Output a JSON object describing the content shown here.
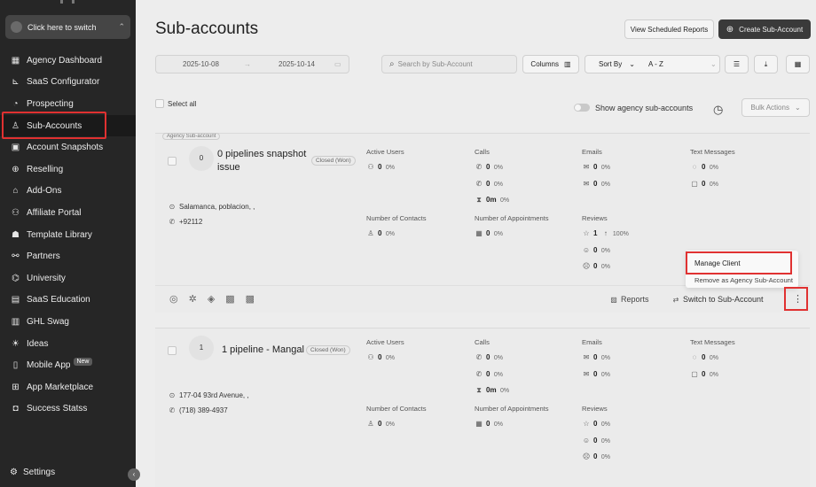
{
  "switcher": {
    "label": "Click here to switch"
  },
  "nav": [
    {
      "label": "Agency Dashboard",
      "icon": "dashboard-icon",
      "glyph": "▦"
    },
    {
      "label": "SaaS Configurator",
      "icon": "chart-icon",
      "glyph": "⊾"
    },
    {
      "label": "Prospecting",
      "icon": "prospecting-icon",
      "glyph": "◔"
    },
    {
      "label": "Sub-Accounts",
      "icon": "user-icon",
      "glyph": "♙",
      "active": true
    },
    {
      "label": "Account Snapshots",
      "icon": "snapshot-icon",
      "glyph": "▣"
    },
    {
      "label": "Reselling",
      "icon": "reselling-icon",
      "glyph": "⊕"
    },
    {
      "label": "Add-Ons",
      "icon": "bag-icon",
      "glyph": "⌂"
    },
    {
      "label": "Affiliate Portal",
      "icon": "affiliate-icon",
      "glyph": "⚇"
    },
    {
      "label": "Template Library",
      "icon": "template-icon",
      "glyph": "☗"
    },
    {
      "label": "Partners",
      "icon": "handshake-icon",
      "glyph": "⚯"
    },
    {
      "label": "University",
      "icon": "graduation-icon",
      "glyph": "⌬"
    },
    {
      "label": "SaaS Education",
      "icon": "education-icon",
      "glyph": "▤"
    },
    {
      "label": "GHL Swag",
      "icon": "swag-icon",
      "glyph": "▥"
    },
    {
      "label": "Ideas",
      "icon": "bulb-icon",
      "glyph": "☀"
    },
    {
      "label": "Mobile App",
      "icon": "mobile-icon",
      "glyph": "▯",
      "badge": "New"
    },
    {
      "label": "App Marketplace",
      "icon": "marketplace-icon",
      "glyph": "⊞"
    },
    {
      "label": "Success Statss",
      "icon": "stats-icon",
      "glyph": "◘"
    }
  ],
  "settings": {
    "label": "Settings"
  },
  "page": {
    "title": "Sub-accounts"
  },
  "header": {
    "view_reports": "View Scheduled Reports",
    "create": "Create Sub-Account"
  },
  "filters": {
    "date_from": "2025-10-08",
    "date_to": "2025-10-14",
    "search_placeholder": "Search by Sub-Account",
    "columns": "Columns",
    "sort_by": "Sort By",
    "sort_value": "A - Z"
  },
  "bulk": {
    "select_all": "Select all",
    "show_agency": "Show agency sub-accounts",
    "bulk_actions": "Bulk Actions"
  },
  "labels": {
    "active_users": "Active Users",
    "calls": "Calls",
    "emails": "Emails",
    "text_messages": "Text Messages",
    "contacts": "Number of Contacts",
    "appointments": "Number of Appointments",
    "reviews": "Reviews"
  },
  "cards": [
    {
      "tag": "Agency Sub-account",
      "index": "0",
      "name_line1": "0 pipelines snapshot",
      "name_line2": "issue",
      "status": "Closed (Won)",
      "address": "Salamanca, poblacion, ,",
      "phone": "+92112",
      "active_users": {
        "v": "0",
        "p": "0%"
      },
      "calls": [
        {
          "v": "0",
          "p": "0%"
        },
        {
          "v": "0",
          "p": "0%"
        },
        {
          "v": "0m",
          "p": "0%"
        }
      ],
      "emails": [
        {
          "v": "0",
          "p": "0%"
        },
        {
          "v": "0",
          "p": "0%"
        }
      ],
      "texts": [
        {
          "v": "0",
          "p": "0%"
        },
        {
          "v": "0",
          "p": "0%"
        }
      ],
      "contacts": {
        "v": "0",
        "p": "0%"
      },
      "appointments": {
        "v": "0",
        "p": "0%"
      },
      "reviews": [
        {
          "v": "1",
          "p": "100%"
        },
        {
          "v": "0",
          "p": "0%"
        },
        {
          "v": "0",
          "p": "0%"
        }
      ],
      "reports": "Reports",
      "switch": "Switch to Sub-Account"
    },
    {
      "index": "1",
      "name_line1": "1 pipeline - Mangal",
      "status": "Closed (Won)",
      "address": "177-04 93rd Avenue, ,",
      "phone": "(718) 389-4937",
      "active_users": {
        "v": "0",
        "p": "0%"
      },
      "calls": [
        {
          "v": "0",
          "p": "0%"
        },
        {
          "v": "0",
          "p": "0%"
        },
        {
          "v": "0m",
          "p": "0%"
        }
      ],
      "emails": [
        {
          "v": "0",
          "p": "0%"
        },
        {
          "v": "0",
          "p": "0%"
        }
      ],
      "texts": [
        {
          "v": "0",
          "p": "0%"
        },
        {
          "v": "0",
          "p": "0%"
        }
      ],
      "contacts": {
        "v": "0",
        "p": "0%"
      },
      "appointments": {
        "v": "0",
        "p": "0%"
      },
      "reviews": [
        {
          "v": "0",
          "p": "0%"
        },
        {
          "v": "0",
          "p": "0%"
        },
        {
          "v": "0",
          "p": "0%"
        }
      ]
    }
  ],
  "menu": {
    "manage": "Manage Client",
    "remove": "Remove as Agency Sub-Account"
  }
}
